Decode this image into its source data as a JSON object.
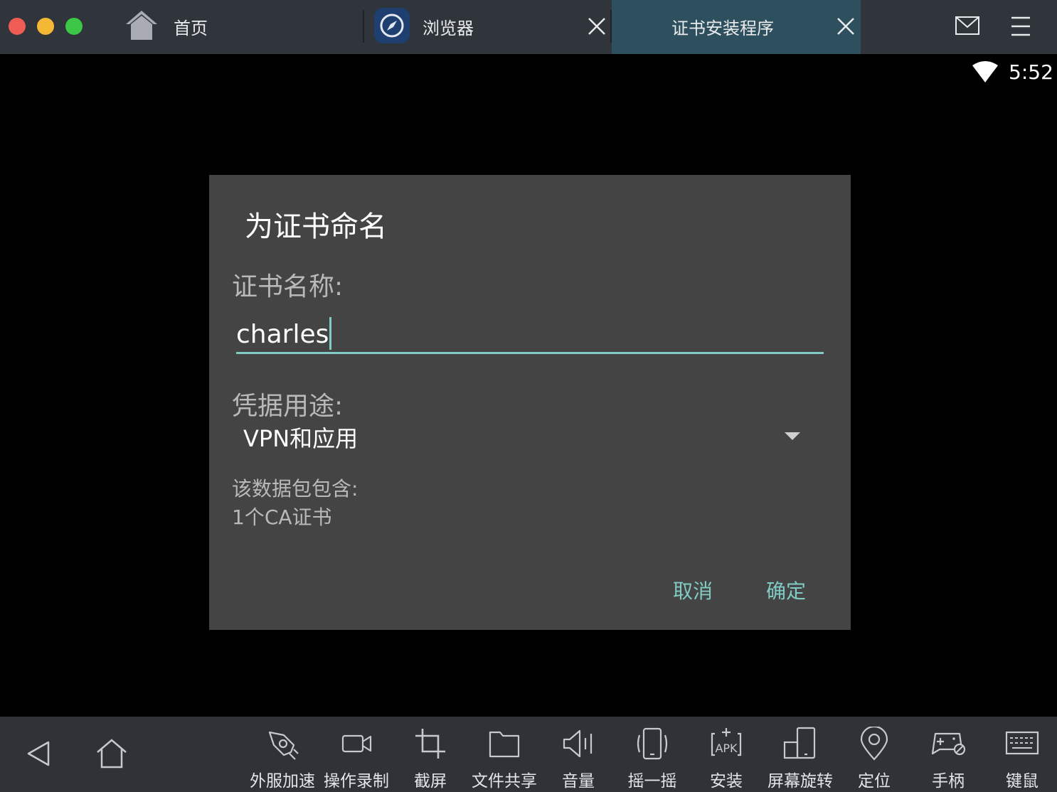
{
  "tabs": {
    "home": {
      "label": "首页"
    },
    "browser": {
      "label": "浏览器"
    },
    "cert_installer": {
      "label": "证书安装程序",
      "active": true
    }
  },
  "status_bar": {
    "time": "5:52"
  },
  "dialog": {
    "title": "为证书命名",
    "name_label": "证书名称:",
    "name_value": "charles",
    "usage_label": "凭据用途:",
    "usage_value": "VPN和应用",
    "package_label": "该数据包包含:",
    "package_content": "1个CA证书",
    "cancel": "取消",
    "confirm": "确定"
  },
  "toolbar": {
    "tools": [
      {
        "label": "外服加速",
        "icon": "rocket-icon"
      },
      {
        "label": "操作录制",
        "icon": "video-camera-icon"
      },
      {
        "label": "截屏",
        "icon": "crop-icon"
      },
      {
        "label": "文件共享",
        "icon": "folder-icon"
      },
      {
        "label": "音量",
        "icon": "speaker-icon"
      },
      {
        "label": "摇一摇",
        "icon": "shake-phone-icon"
      },
      {
        "label": "安装",
        "icon": "apk-install-icon"
      },
      {
        "label": "屏幕旋转",
        "icon": "rotate-screen-icon"
      },
      {
        "label": "定位",
        "icon": "location-pin-icon"
      },
      {
        "label": "手柄",
        "icon": "gamepad-icon"
      },
      {
        "label": "键鼠",
        "icon": "keyboard-icon"
      }
    ]
  },
  "colors": {
    "accent": "#80cbc4",
    "dialog_bg": "#444444",
    "topbar_bg": "#30343b",
    "active_tab_bg": "#2e4f5d"
  }
}
